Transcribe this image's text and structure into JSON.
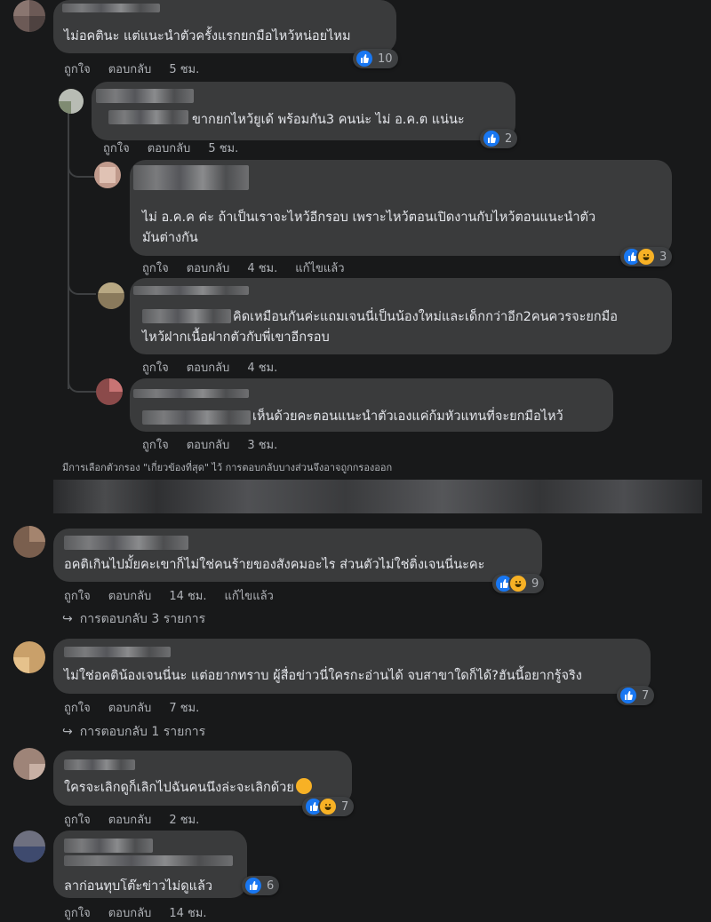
{
  "common": {
    "like": "ถูกใจ",
    "reply": "ตอบกลับ",
    "edited": "แก้ไขแล้ว"
  },
  "c1": {
    "line1": "ไม่อคตินะ แต่แนะนำตัวครั้งแรกยกมือไหว้หน่อยไหม",
    "time": "5 ชม.",
    "reactions": "10"
  },
  "r1": {
    "line1": "ขากยกไหว้ยูเด้ พร้อมกัน3 คนน่ะ ไม่ อ.ค.ต แน่นะ",
    "time": "5 ชม.",
    "reactions": "2"
  },
  "r2": {
    "line1": "ไม่ อ.ค.ค ค่ะ ถ้าเป็นเราจะไหว้อีกรอบ เพราะไหว้ตอนเปิดงานกับไหว้ตอนแนะนำตัว",
    "line2": "มันต่างกัน",
    "time": "4 ชม.",
    "reactions": "3"
  },
  "r3": {
    "line1": "คิดเหมือนกันค่ะแถมเจนนี่เป็นน้องใหม่และเด็กกว่าอีก2คนควรจะยกมือ",
    "line2": "ไหว้ฝากเนื้อฝากตัวกับพี่เขาอีกรอบ",
    "time": "4 ชม."
  },
  "r4": {
    "line1": "เห็นด้วยคะตอนแนะนำตัวเองแค่ก้มหัวแทนที่จะยกมือไหว้",
    "time": "3 ชม."
  },
  "filter_note": "มีการเลือกตัวกรอง \"เกี่ยวข้องที่สุด\" ไว้ การตอบกลับบางส่วนจึงอาจถูกกรองออก",
  "c2": {
    "line1": "อคติเกินไปมั้ยคะเขาก็ไม่ใช่คนร้ายของสังคมอะไร ส่วนตัวไม่ใช่ติ่งเจนนี่นะคะ",
    "time": "14 ชม.",
    "reactions": "9",
    "replies": "การตอบกลับ 3 รายการ"
  },
  "c3": {
    "line1": "ไม่ใช่อคติน้องเจนนี่นะ แต่อยากทราบ ผู้สื่อข่าวนี่ใครกะอ่านได้ จบสาขาใดก็ได้?ฮันนี้อยากรู้จริง",
    "time": "7 ชม.",
    "reactions": "7",
    "replies": "การตอบกลับ 1 รายการ"
  },
  "c4": {
    "line1": "ใครจะเลิกดูก็เลิกไปฉันคนนึงล่ะจะเลิกด้วย",
    "time": "2 ชม.",
    "reactions": "7"
  },
  "c5": {
    "line1": "ลาก่อนทุบโต๊ะข่าวไม่ดูแล้ว",
    "time": "14 ชม.",
    "reactions": "6"
  }
}
